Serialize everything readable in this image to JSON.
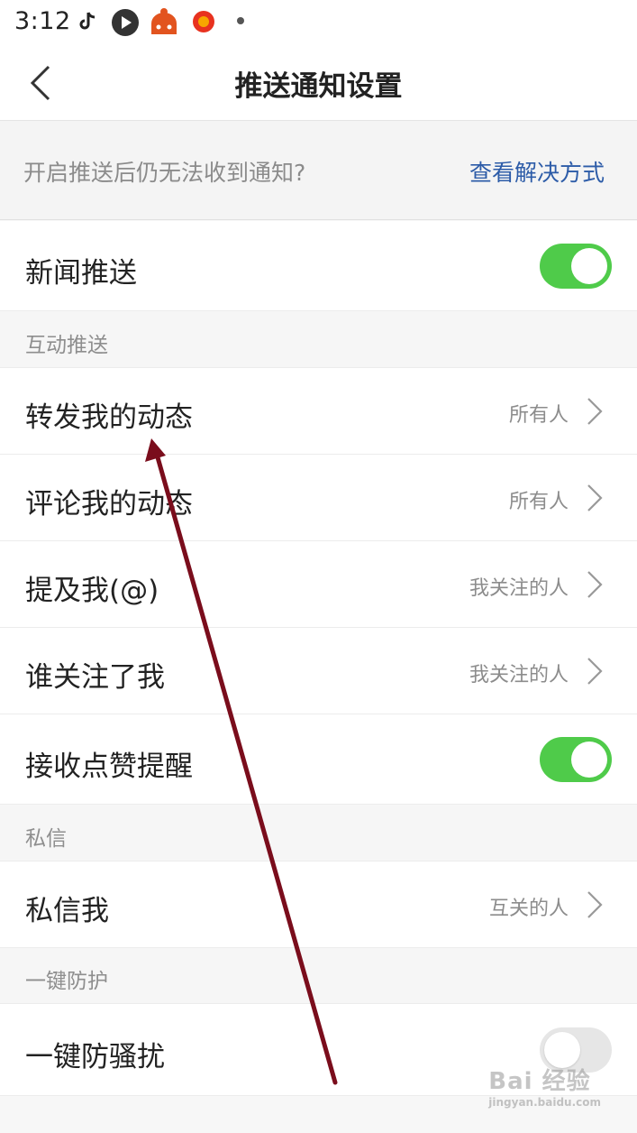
{
  "status_bar": {
    "time": "3:12"
  },
  "header": {
    "title": "推送通知设置"
  },
  "tip": {
    "text": "开启推送后仍无法收到通知?",
    "link": "查看解决方式"
  },
  "news_push": {
    "label": "新闻推送",
    "enabled": true
  },
  "sections": {
    "interactive": {
      "title": "互动推送"
    },
    "private_msg": {
      "title": "私信"
    },
    "protection": {
      "title": "一键防护"
    }
  },
  "interactive_items": [
    {
      "label": "转发我的动态",
      "value": "所有人"
    },
    {
      "label": "评论我的动态",
      "value": "所有人"
    },
    {
      "label": "提及我(@)",
      "value": "我关注的人"
    },
    {
      "label": "谁关注了我",
      "value": "我关注的人"
    }
  ],
  "like_reminder": {
    "label": "接收点赞提醒",
    "enabled": true
  },
  "private_item": {
    "label": "私信我",
    "value": "互关的人"
  },
  "anti_harass": {
    "label": "一键防骚扰",
    "enabled": false
  },
  "watermark": {
    "main": "Bai 经验",
    "sub": "jingyan.baidu.com"
  },
  "colors": {
    "toggle_on": "#4fcb4a",
    "link": "#2d5ca8",
    "arrow": "#7a0d1c"
  }
}
